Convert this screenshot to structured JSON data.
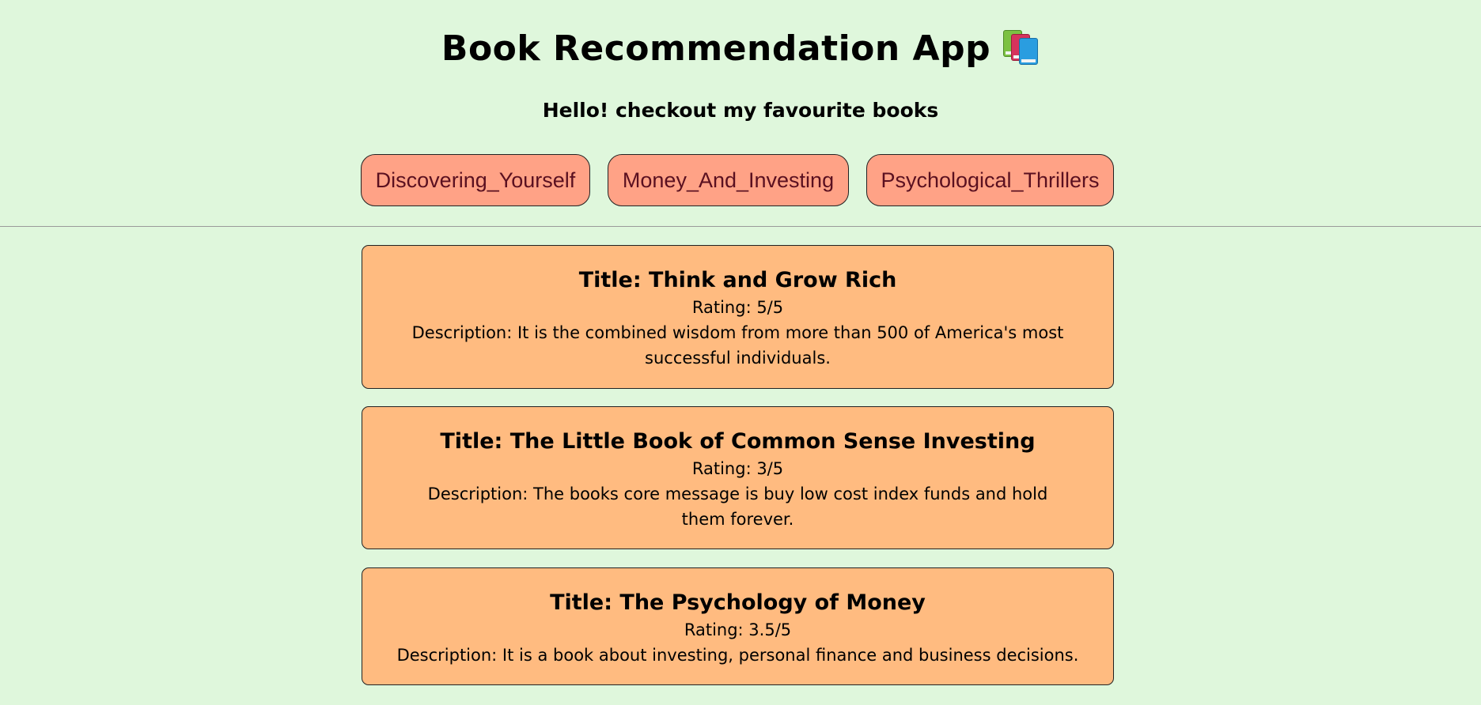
{
  "app": {
    "title": "Book Recommendation App",
    "title_icon": "books-icon",
    "subtitle": "Hello! checkout my favourite books"
  },
  "genres": [
    {
      "label": "Discovering_Yourself"
    },
    {
      "label": "Money_And_Investing"
    },
    {
      "label": "Psychological_Thrillers"
    }
  ],
  "books": [
    {
      "title": "Title: Think and Grow Rich",
      "rating": "Rating: 5/5",
      "description": "Description: It is the combined wisdom from more than 500 of America's most successful individuals."
    },
    {
      "title": "Title: The Little Book of Common Sense Investing",
      "rating": "Rating: 3/5",
      "description": "Description: The books core message is buy low cost index funds and hold them forever."
    },
    {
      "title": "Title: The Psychology of Money",
      "rating": "Rating: 3.5/5",
      "description": "Description: It is a book about investing, personal finance and business decisions."
    }
  ],
  "colors": {
    "background": "#dff7dc",
    "genre_button": "#ffa286",
    "card": "#ffbb80"
  }
}
